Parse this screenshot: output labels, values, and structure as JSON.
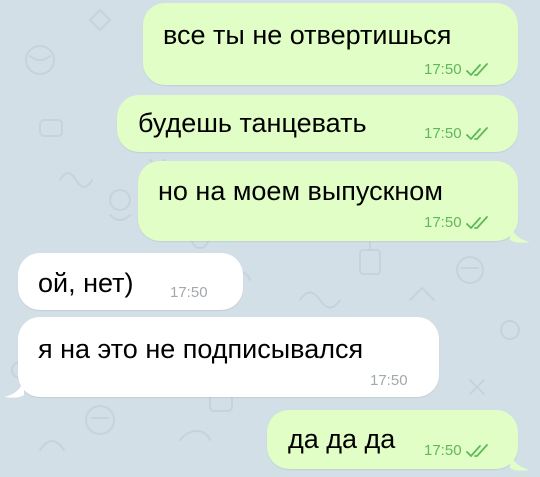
{
  "colors": {
    "chat_background": "#d3dfe7",
    "outgoing_bubble": "#e1fec6",
    "incoming_bubble": "#ffffff",
    "outgoing_time": "#5fb85a",
    "incoming_time": "#a3a9ad",
    "read_checks": "#5fb85a"
  },
  "messages": [
    {
      "direction": "outgoing",
      "text": "все ты не отвертишься",
      "time": "17:50",
      "status_icon": "double-check-read-icon"
    },
    {
      "direction": "outgoing",
      "text": "будешь танцевать",
      "time": "17:50",
      "status_icon": "double-check-read-icon"
    },
    {
      "direction": "outgoing",
      "text": "но на моем выпускном",
      "time": "17:50",
      "status_icon": "double-check-read-icon"
    },
    {
      "direction": "incoming",
      "text": "ой, нет)",
      "time": "17:50"
    },
    {
      "direction": "incoming",
      "text": "я на это не подписывался",
      "time": "17:50"
    },
    {
      "direction": "outgoing",
      "text": "да да да",
      "time": "17:50",
      "status_icon": "double-check-read-icon"
    }
  ]
}
